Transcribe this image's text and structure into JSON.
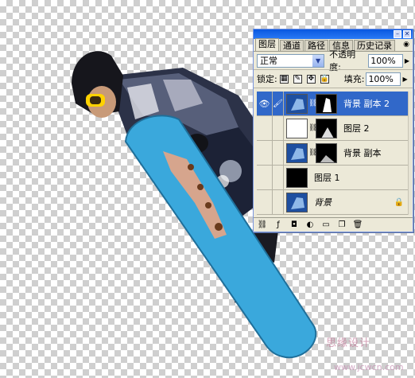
{
  "panel": {
    "tabs": [
      "图层",
      "通道",
      "路径",
      "信息",
      "历史记录"
    ],
    "active_tab": "图层",
    "blend_mode": "正常",
    "opacity_label": "不透明度:",
    "opacity_value": "100%",
    "lock_label": "锁定:",
    "fill_label": "填充:",
    "fill_value": "100%",
    "layers": [
      {
        "name": "背景 副本 2",
        "visible": true,
        "selected": true,
        "has_mask": true
      },
      {
        "name": "图层 2",
        "visible": false,
        "selected": false,
        "has_mask": true
      },
      {
        "name": "背景 副本",
        "visible": false,
        "selected": false,
        "has_mask": true
      },
      {
        "name": "图层 1",
        "visible": false,
        "selected": false,
        "has_mask": false
      },
      {
        "name": "背景",
        "visible": false,
        "selected": false,
        "has_mask": false,
        "locked": true
      }
    ],
    "icons": {
      "eye": "eye-icon",
      "brush": "brush-icon",
      "chain": "link-icon",
      "lock": "lock-icon"
    }
  },
  "watermark": {
    "text": "思缘设计",
    "url": "www.jcwcn.com"
  },
  "colors": {
    "panel_bg": "#ece9d8",
    "titlebar": "#0a58e0",
    "selected_row": "#3168c9",
    "snowboard": "#3aa8dc"
  }
}
